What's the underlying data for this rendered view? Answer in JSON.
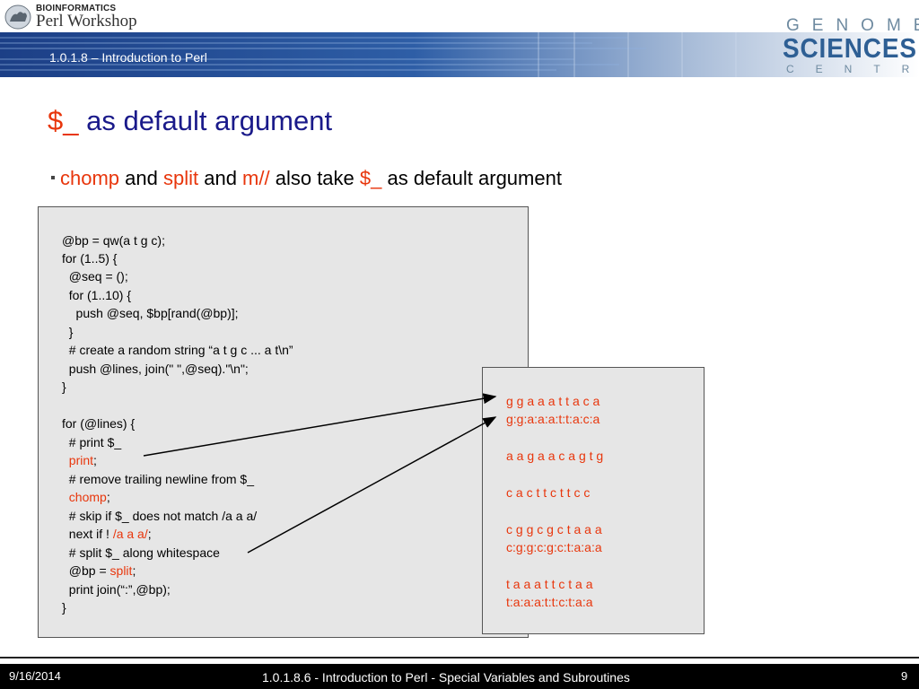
{
  "header": {
    "logo_top": "BIOINFORMATICS",
    "logo_bottom": "Perl Workshop",
    "subtitle": "1.0.1.8 – Introduction to Perl",
    "gsc_line1": "GENOME",
    "gsc_line2": "SCIENCES",
    "gsc_line3": "CENTRE"
  },
  "slide": {
    "title_var": "$_",
    "title_rest": " as default argument",
    "bullet": {
      "w1": "chomp",
      "w2": " and ",
      "w3": "split",
      "w4": " and ",
      "w5": "m//",
      "w6": " also take ",
      "w7": "$_",
      "w8": " as default argument"
    }
  },
  "code": {
    "l1": "@bp = qw(a t g c);",
    "l2": "for (1..5) {",
    "l3": "  @seq = ();",
    "l4": "  for (1..10) {",
    "l5": "    push @seq, $bp[rand(@bp)];",
    "l6": "  }",
    "l7": "  # create a random string “a t g c ... a t\\n”",
    "l8": "  push @lines, join(\" \",@seq).\"\\n\";",
    "l9": "}",
    "l10": "for (@lines) {",
    "l11": "  # print $_",
    "l12a": "  print",
    "l12b": ";",
    "l13": "  # remove trailing newline from $_",
    "l14a": "  chomp",
    "l14b": ";",
    "l15": "  # skip if $_ does not match /a a a/",
    "l16a": "  next if ! ",
    "l16b": "/a a a/",
    "l16c": ";",
    "l17": "  # split $_ along whitespace",
    "l18a": "  @bp = ",
    "l18b": "split",
    "l18c": ";",
    "l19": "  print join(“:”,@bp);",
    "l20": "}"
  },
  "output": {
    "o1": "g g a a a t t a c a",
    "o2": "g:g:a:a:a:t:t:a:c:a",
    "o3": "a a g a a c a g t g",
    "o4": "c a c t t c t t c c",
    "o5": "c g g c g c t a a a",
    "o6": "c:g:g:c:g:c:t:a:a:a",
    "o7": "t a a a t t c t a a",
    "o8": "t:a:a:a:t:t:c:t:a:a"
  },
  "footer": {
    "date": "9/16/2014",
    "center": "1.0.1.8.6 - Introduction to Perl - Special Variables and Subroutines",
    "page": "9"
  },
  "colors": {
    "title_blue": "#1a1a8a",
    "accent_red": "#e8360c",
    "comment_blue": "#3a8fd6",
    "banner_blue": "#2e5f94"
  }
}
